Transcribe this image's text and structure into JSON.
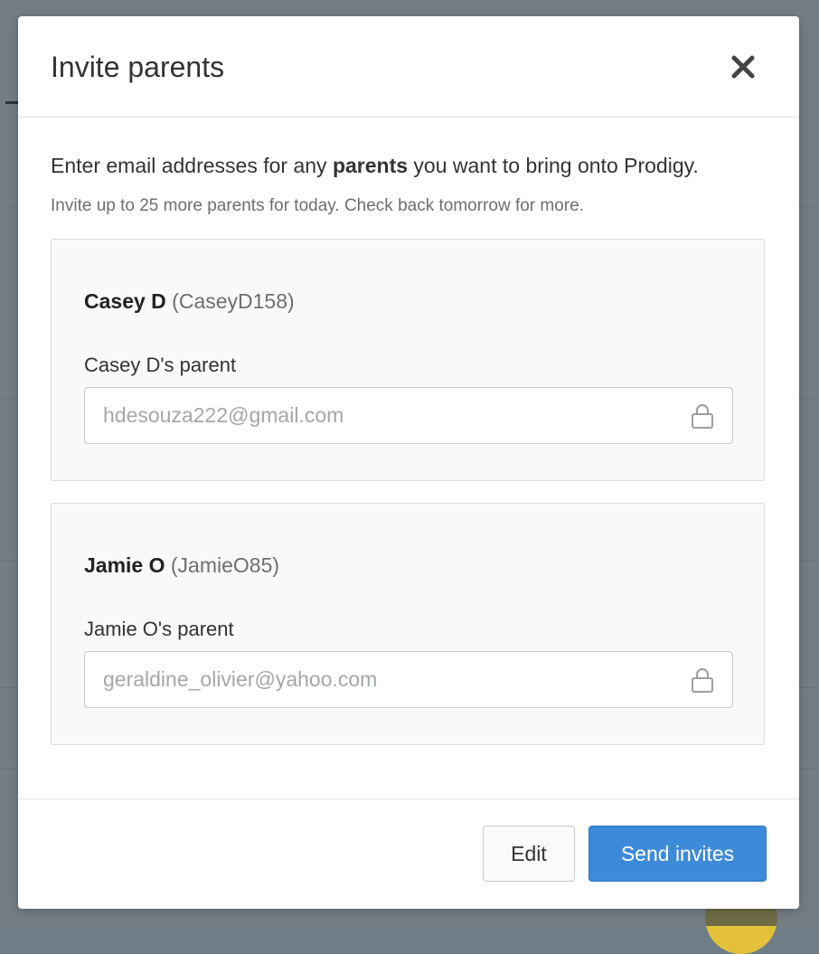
{
  "modal": {
    "title": "Invite parents",
    "intro_prefix": "Enter email addresses for any ",
    "intro_bold": "parents",
    "intro_suffix": " you want to bring onto Prodigy.",
    "note": "Invite up to 25 more parents for today. Check back tomorrow for more.",
    "icons": {
      "close": "close-icon",
      "lock": "lock-icon"
    }
  },
  "students": [
    {
      "name": "Casey D",
      "username": "(CaseyD158)",
      "parent_label": "Casey D's parent",
      "email": "hdesouza222@gmail.com"
    },
    {
      "name": "Jamie O",
      "username": "(JamieO85)",
      "parent_label": "Jamie O's parent",
      "email": "geraldine_olivier@yahoo.com"
    }
  ],
  "footer": {
    "edit_label": "Edit",
    "send_label": "Send invites"
  },
  "colors": {
    "primary": "#3d8bd8",
    "overlay": "#2f3e4a"
  }
}
